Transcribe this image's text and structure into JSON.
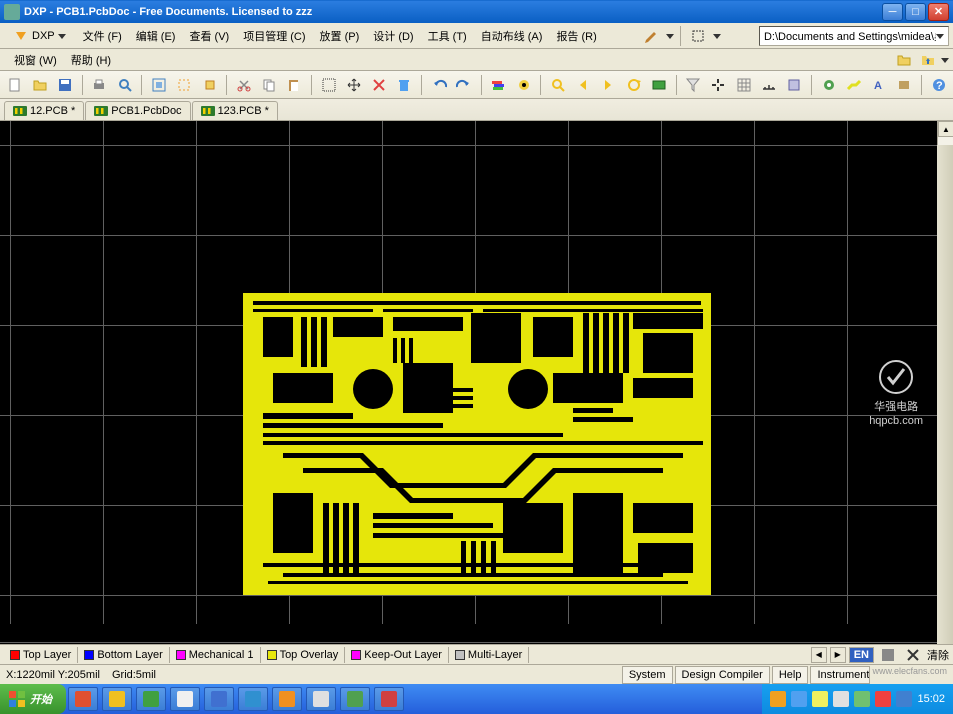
{
  "titlebar": {
    "title": "DXP - PCB1.PcbDoc - Free Documents. Licensed to zzz"
  },
  "menubar": {
    "dxp_label": "DXP",
    "items_row1": [
      "文件 (F)",
      "编辑 (E)",
      "查看 (V)",
      "项目管理 (C)",
      "放置 (P)",
      "设计 (D)",
      "工具 (T)",
      "自动布线 (A)",
      "报告 (R)"
    ],
    "items_row2": [
      "视窗 (W)",
      "帮助 (H)"
    ],
    "path_value": "D:\\Documents and Settings\\midea\\桌面"
  },
  "doctabs": [
    {
      "label": "12.PCB *"
    },
    {
      "label": "PCB1.PcbDoc"
    },
    {
      "label": "123.PCB *"
    }
  ],
  "layertabs": [
    {
      "label": "Top Layer",
      "color": "#ff0000"
    },
    {
      "label": "Bottom Layer",
      "color": "#0000ff"
    },
    {
      "label": "Mechanical 1",
      "color": "#ff00ff"
    },
    {
      "label": "Top Overlay",
      "color": "#e6e60a"
    },
    {
      "label": "Keep-Out Layer",
      "color": "#ff00ff"
    },
    {
      "label": "Multi-Layer",
      "color": "#c0c0c0"
    }
  ],
  "statusbar": {
    "coords": "X:1220mil Y:205mil",
    "grid": "Grid:5mil",
    "buttons": [
      "System",
      "Design Compiler",
      "Help",
      "Instruments"
    ],
    "lang": "EN",
    "clear": "清除"
  },
  "taskbar": {
    "start_label": "开始",
    "clock": "15:02"
  },
  "watermark": {
    "line1": "华强电路",
    "line2": "hqpcb.com",
    "bottom": "www.elecfans.com"
  }
}
